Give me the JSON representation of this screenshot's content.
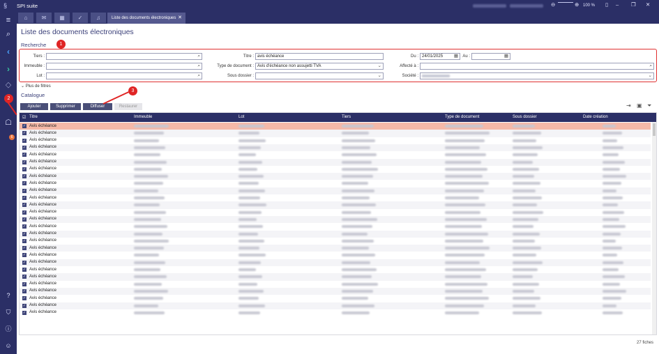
{
  "app": {
    "title": "SPI suite"
  },
  "window_controls": {
    "zoom": "100 %"
  },
  "tabs": {
    "active_label": "Liste des documents électroniques"
  },
  "page": {
    "title": "Liste des documents électroniques"
  },
  "search": {
    "section_label": "Recherche",
    "tiers_label": "Tiers :",
    "immeuble_label": "Immeuble :",
    "lot_label": "Lot :",
    "titre_label": "Titre :",
    "titre_value": "avis échéance",
    "type_label": "Type de document :",
    "type_value": "Avis d'échéance non assujetti TVA",
    "sousdossier_label": "Sous dossier :",
    "du_label": "Du :",
    "du_value": "24/01/2025",
    "au_label": "Au :",
    "affecte_label": "Affecté à :",
    "societe_label": "Société :",
    "more_filters": "Plus de filtres"
  },
  "callouts": [
    "1",
    "2",
    "3"
  ],
  "badge_count": "6",
  "catalogue": {
    "section_label": "Catalogue",
    "buttons": {
      "add": "Ajouter",
      "delete": "Supprimer",
      "broadcast": "Diffuser",
      "restore": "Restaurer"
    },
    "columns": [
      "Titre",
      "Immeuble",
      "Lot",
      "Tiers",
      "Type de document",
      "Sous dossier",
      "Date création"
    ],
    "rows": [
      "Avis échéance",
      "Avis échéance",
      "Avis échéance",
      "Avis échéance",
      "Avis échéance",
      "Avis échéance",
      "Avis échéance",
      "Avis échéance",
      "Avis échéance",
      "Avis échéance",
      "Avis échéance",
      "Avis échéance",
      "Avis échéance",
      "Avis échéance",
      "Avis échéance",
      "Avis échéance",
      "Avis échéance",
      "Avis échéance",
      "Avis échéance",
      "Avis échéance",
      "Avis échéance",
      "Avis échéance",
      "Avis échéance",
      "Avis échéance",
      "Avis échéance",
      "Avis échéance",
      "Avis échéance"
    ],
    "count_label": "27 fiches"
  },
  "colors": {
    "navy": "#2b2f66",
    "accent_red": "#e02525",
    "selected_row": "#f6b9a8"
  }
}
